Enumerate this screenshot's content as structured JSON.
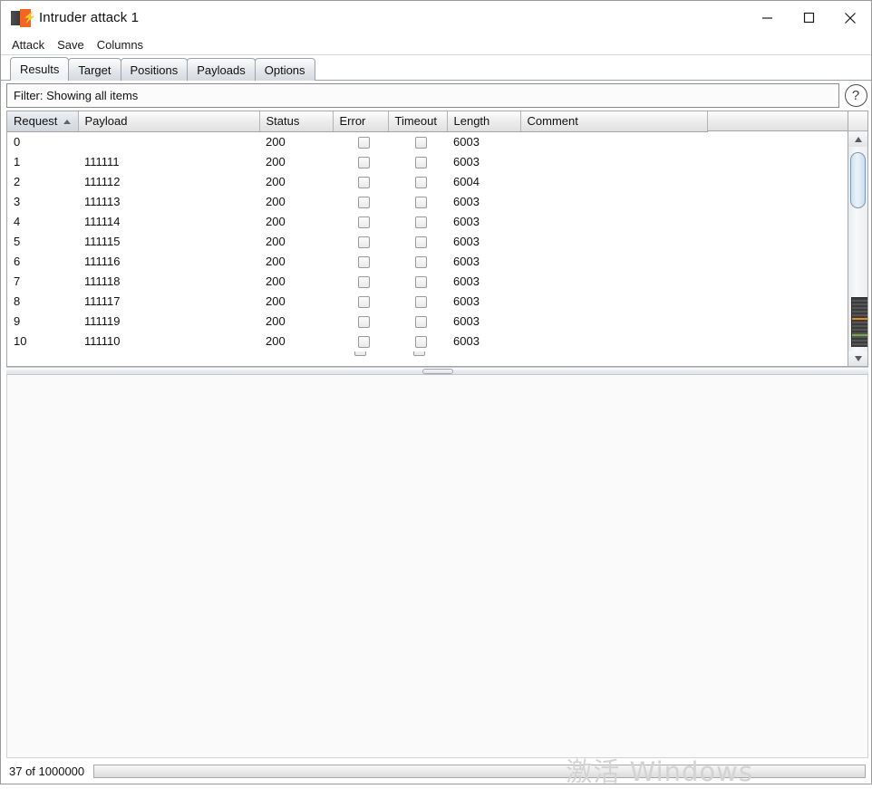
{
  "window": {
    "title": "Intruder attack 1",
    "icon": "burp-suite-icon",
    "controls": {
      "minimize": "minimize-icon",
      "maximize": "maximize-icon",
      "close": "close-icon"
    }
  },
  "menubar": {
    "items": [
      {
        "label": "Attack"
      },
      {
        "label": "Save"
      },
      {
        "label": "Columns"
      }
    ]
  },
  "tabs": [
    {
      "label": "Results",
      "active": true
    },
    {
      "label": "Target",
      "active": false
    },
    {
      "label": "Positions",
      "active": false
    },
    {
      "label": "Payloads",
      "active": false
    },
    {
      "label": "Options",
      "active": false
    }
  ],
  "filter": {
    "text": "Filter: Showing all items",
    "help_label": "?"
  },
  "table": {
    "columns": [
      {
        "label": "Request",
        "sorted": "asc"
      },
      {
        "label": "Payload",
        "sorted": null
      },
      {
        "label": "Status",
        "sorted": null
      },
      {
        "label": "Error",
        "sorted": null
      },
      {
        "label": "Timeout",
        "sorted": null
      },
      {
        "label": "Length",
        "sorted": null
      },
      {
        "label": "Comment",
        "sorted": null
      }
    ],
    "rows": [
      {
        "request": "0",
        "payload": "",
        "status": "200",
        "error": false,
        "timeout": false,
        "length": "6003",
        "comment": ""
      },
      {
        "request": "1",
        "payload": "111111",
        "status": "200",
        "error": false,
        "timeout": false,
        "length": "6003",
        "comment": ""
      },
      {
        "request": "2",
        "payload": "111112",
        "status": "200",
        "error": false,
        "timeout": false,
        "length": "6004",
        "comment": ""
      },
      {
        "request": "3",
        "payload": "111113",
        "status": "200",
        "error": false,
        "timeout": false,
        "length": "6003",
        "comment": ""
      },
      {
        "request": "4",
        "payload": "111114",
        "status": "200",
        "error": false,
        "timeout": false,
        "length": "6003",
        "comment": ""
      },
      {
        "request": "5",
        "payload": "111115",
        "status": "200",
        "error": false,
        "timeout": false,
        "length": "6003",
        "comment": ""
      },
      {
        "request": "6",
        "payload": "111116",
        "status": "200",
        "error": false,
        "timeout": false,
        "length": "6003",
        "comment": ""
      },
      {
        "request": "7",
        "payload": "111118",
        "status": "200",
        "error": false,
        "timeout": false,
        "length": "6003",
        "comment": ""
      },
      {
        "request": "8",
        "payload": "111117",
        "status": "200",
        "error": false,
        "timeout": false,
        "length": "6003",
        "comment": ""
      },
      {
        "request": "9",
        "payload": "111119",
        "status": "200",
        "error": false,
        "timeout": false,
        "length": "6003",
        "comment": ""
      },
      {
        "request": "10",
        "payload": "111110",
        "status": "200",
        "error": false,
        "timeout": false,
        "length": "6003",
        "comment": ""
      }
    ]
  },
  "scrollbar": {
    "up_arrow": "triangle-up-icon",
    "down_arrow": "triangle-down-icon"
  },
  "statusbar": {
    "progress_text": "37 of 1000000",
    "progress_percent": 0
  },
  "watermark": {
    "text": "激活 Windows"
  },
  "colors": {
    "accent_orange": "#f26522",
    "scroll_thumb": "#cfe0ee",
    "window_border": "#9a9a9a"
  }
}
